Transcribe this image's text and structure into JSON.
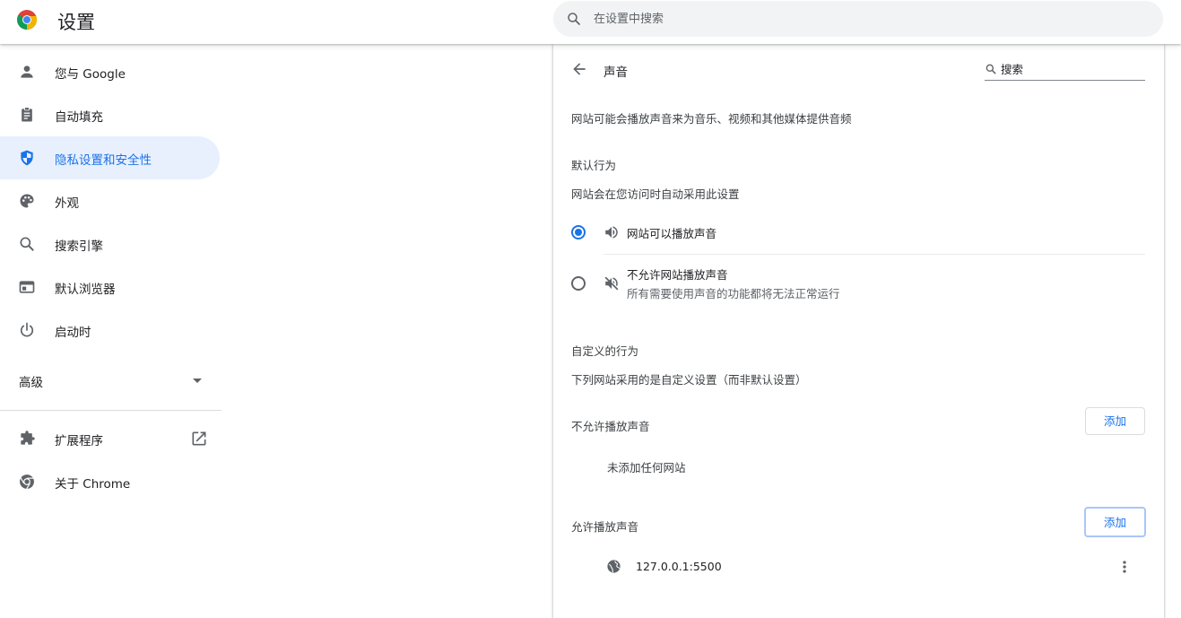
{
  "app": {
    "title": "设置"
  },
  "search": {
    "placeholder": "在设置中搜索"
  },
  "sidebar": {
    "items": [
      {
        "label": "您与 Google",
        "icon": "person-icon"
      },
      {
        "label": "自动填充",
        "icon": "clipboard-icon"
      },
      {
        "label": "隐私设置和安全性",
        "icon": "shield-icon",
        "active": true
      },
      {
        "label": "外观",
        "icon": "palette-icon"
      },
      {
        "label": "搜索引擎",
        "icon": "search-icon"
      },
      {
        "label": "默认浏览器",
        "icon": "browser-window-icon"
      },
      {
        "label": "启动时",
        "icon": "power-icon"
      }
    ],
    "advanced_label": "高级",
    "extensions_label": "扩展程序",
    "about_label": "关于 Chrome"
  },
  "sound": {
    "title": "声音",
    "search_placeholder": "搜索",
    "description": "网站可能会播放声音来为音乐、视频和其他媒体提供音频",
    "default_heading": "默认行为",
    "default_desc": "网站会在您访问时自动采用此设置",
    "option_allow": "网站可以播放声音",
    "option_block": "不允许网站播放声音",
    "option_block_desc": "所有需要使用声音的功能都将无法正常运行",
    "custom_heading": "自定义的行为",
    "custom_desc": "下列网站采用的是自定义设置（而非默认设置）",
    "blocked_heading": "不允许播放声音",
    "blocked_empty": "未添加任何网站",
    "allowed_heading": "允许播放声音",
    "add_label": "添加",
    "allowed_sites": [
      "127.0.0.1:5500"
    ]
  },
  "colors": {
    "accent": "#1a73e8",
    "active_bg": "#e8f0fe"
  }
}
